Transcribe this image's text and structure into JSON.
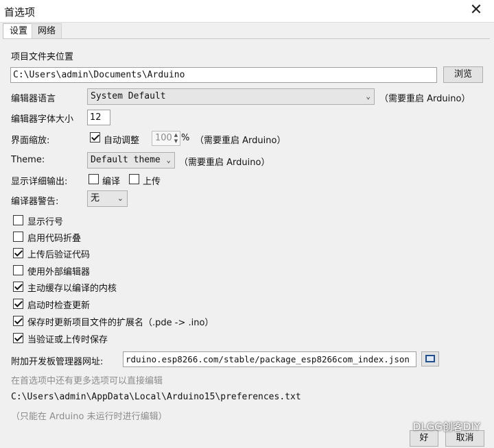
{
  "window": {
    "title": "首选项",
    "close_glyph": "✕"
  },
  "tabs": [
    {
      "label": "设置",
      "active": true
    },
    {
      "label": "网络",
      "active": false
    }
  ],
  "sketchbook": {
    "label": "项目文件夹位置",
    "value": "C:\\Users\\admin\\Documents\\Arduino",
    "browse_label": "浏览"
  },
  "editor_language": {
    "label": "编辑器语言",
    "value": "System Default",
    "note": "（需要重启 Arduino）"
  },
  "font_size": {
    "label": "编辑器字体大小",
    "value": "12"
  },
  "scale": {
    "label": "界面缩放:",
    "auto_label": "自动调整",
    "auto_checked": true,
    "value": "100",
    "unit": "%",
    "note": "（需要重启 Arduino）"
  },
  "theme": {
    "label": "Theme:",
    "value": "Default theme",
    "note": "（需要重启 Arduino）"
  },
  "verbose": {
    "label": "显示详细输出:",
    "compile_label": "编译",
    "compile_checked": false,
    "upload_label": "上传",
    "upload_checked": false
  },
  "warnings": {
    "label": "编译器警告:",
    "value": "无"
  },
  "options": [
    {
      "label": "显示行号",
      "checked": false
    },
    {
      "label": "启用代码折叠",
      "checked": false
    },
    {
      "label": "上传后验证代码",
      "checked": true
    },
    {
      "label": "使用外部编辑器",
      "checked": false
    },
    {
      "label": "主动缓存以编译的内核",
      "checked": true
    },
    {
      "label": "启动时检查更新",
      "checked": true
    },
    {
      "label": "保存时更新项目文件的扩展名（.pde -> .ino）",
      "checked": true
    },
    {
      "label": "当验证或上传时保存",
      "checked": true
    }
  ],
  "boards_manager": {
    "label": "附加开发板管理器网址:",
    "value": "rduino.esp8266.com/stable/package_esp8266com_index.json"
  },
  "more_prefs_note": "在首选项中还有更多选项可以直接编辑",
  "prefs_path": "C:\\Users\\admin\\AppData\\Local\\Arduino15\\preferences.txt",
  "edit_note": "（只能在 Arduino 未运行时进行编辑）",
  "footer": {
    "ok_label": "好",
    "cancel_label": "取消"
  },
  "watermark": "DLGG创客DIY"
}
